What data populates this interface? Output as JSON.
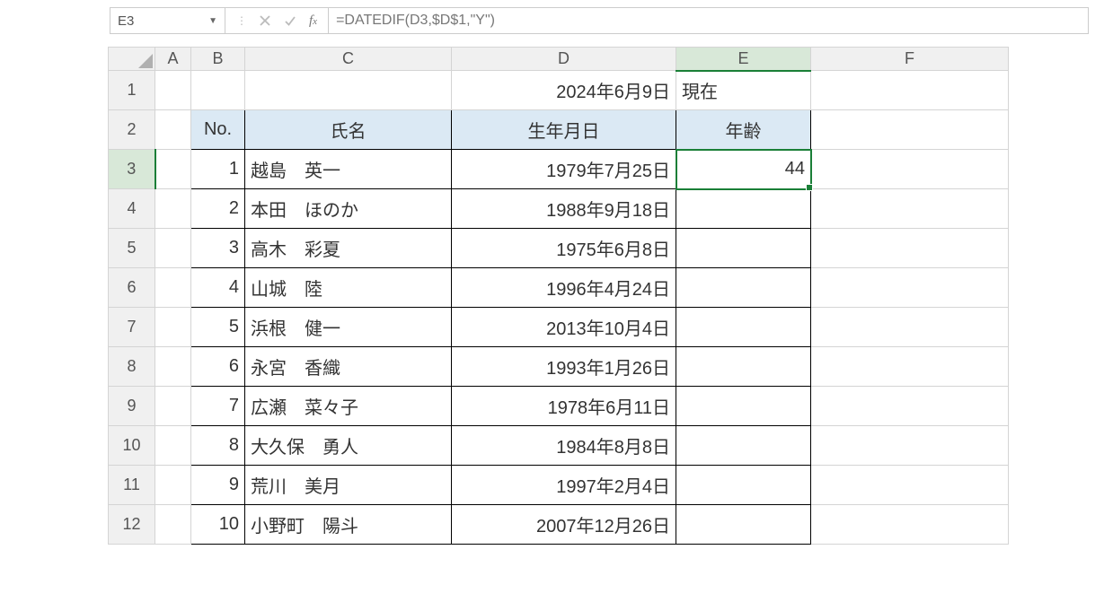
{
  "formula_bar": {
    "name_box": "E3",
    "formula": "=DATEDIF(D3,$D$1,\"Y\")"
  },
  "columns": [
    "A",
    "B",
    "C",
    "D",
    "E",
    "F"
  ],
  "row_headers": [
    "1",
    "2",
    "3",
    "4",
    "5",
    "6",
    "7",
    "8",
    "9",
    "10",
    "11",
    "12"
  ],
  "meta": {
    "date_cell": "2024年6月9日",
    "date_label": "現在"
  },
  "headers": {
    "no": "No.",
    "name": "氏名",
    "dob": "生年月日",
    "age": "年齢"
  },
  "rows": [
    {
      "no": "1",
      "name": "越島　英一",
      "dob": "1979年7月25日",
      "age": "44"
    },
    {
      "no": "2",
      "name": "本田　ほのか",
      "dob": "1988年9月18日",
      "age": ""
    },
    {
      "no": "3",
      "name": "高木　彩夏",
      "dob": "1975年6月8日",
      "age": ""
    },
    {
      "no": "4",
      "name": "山城　陸",
      "dob": "1996年4月24日",
      "age": ""
    },
    {
      "no": "5",
      "name": "浜根　健一",
      "dob": "2013年10月4日",
      "age": ""
    },
    {
      "no": "6",
      "name": "永宮　香織",
      "dob": "1993年1月26日",
      "age": ""
    },
    {
      "no": "7",
      "name": "広瀬　菜々子",
      "dob": "1978年6月11日",
      "age": ""
    },
    {
      "no": "8",
      "name": "大久保　勇人",
      "dob": "1984年8月8日",
      "age": ""
    },
    {
      "no": "9",
      "name": "荒川　美月",
      "dob": "1997年2月4日",
      "age": ""
    },
    {
      "no": "10",
      "name": "小野町　陽斗",
      "dob": "2007年12月26日",
      "age": ""
    }
  ],
  "active_cell": "E3"
}
